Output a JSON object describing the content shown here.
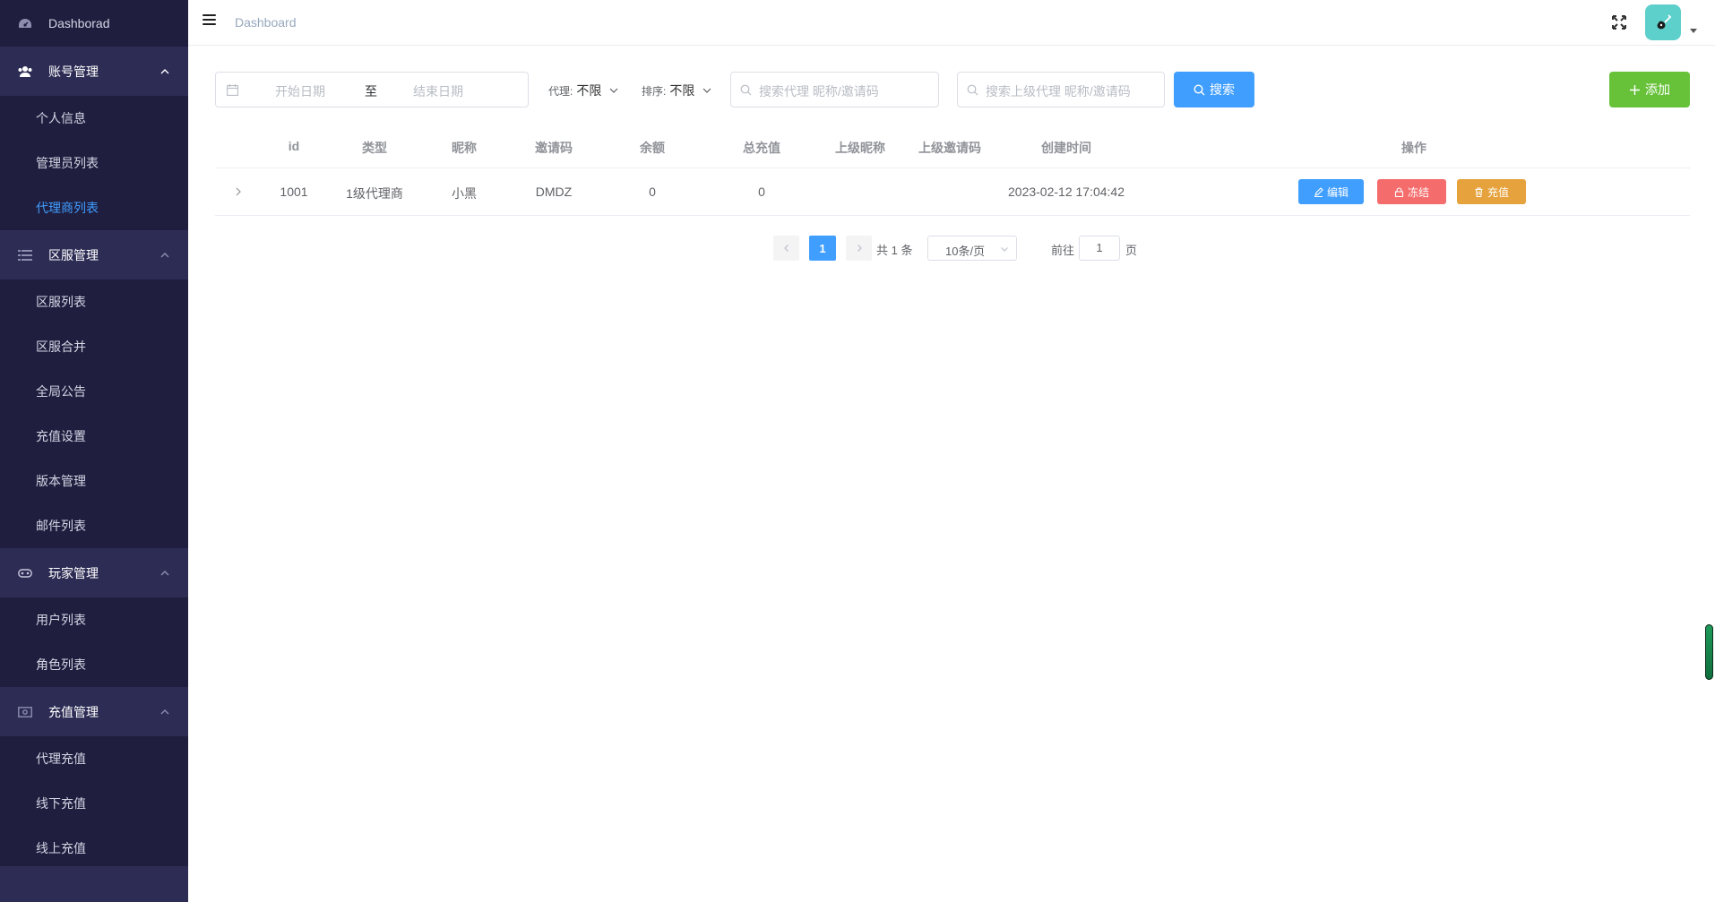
{
  "header": {
    "breadcrumb": "Dashboard"
  },
  "sidebar": {
    "top_item": {
      "label": "Dashborad",
      "icon": "dashboard-icon"
    },
    "groups": [
      {
        "label": "账号管理",
        "icon": "users-icon",
        "items": [
          {
            "label": "个人信息"
          },
          {
            "label": "管理员列表"
          },
          {
            "label": "代理商列表",
            "active": true
          }
        ]
      },
      {
        "label": "区服管理",
        "icon": "list-icon",
        "items": [
          {
            "label": "区服列表"
          },
          {
            "label": "区服合并"
          },
          {
            "label": "全局公告"
          },
          {
            "label": "充值设置"
          },
          {
            "label": "版本管理"
          },
          {
            "label": "邮件列表"
          }
        ]
      },
      {
        "label": "玩家管理",
        "icon": "gamepad-icon",
        "items": [
          {
            "label": "用户列表"
          },
          {
            "label": "角色列表"
          }
        ]
      },
      {
        "label": "充值管理",
        "icon": "money-icon",
        "items": [
          {
            "label": "代理充值"
          },
          {
            "label": "线下充值"
          },
          {
            "label": "线上充值"
          }
        ]
      }
    ]
  },
  "filters": {
    "date_start_placeholder": "开始日期",
    "date_separator": "至",
    "date_end_placeholder": "结束日期",
    "agent_label": "代理:",
    "agent_value": "不限",
    "sort_label": "排序:",
    "sort_value": "不限",
    "search_placeholder": "搜索代理 昵称/邀请码",
    "parent_search_placeholder": "搜索上级代理 昵称/邀请码",
    "search_button": "搜索",
    "add_button": "添加"
  },
  "table": {
    "headers": [
      "id",
      "类型",
      "昵称",
      "邀请码",
      "余额",
      "总充值",
      "上级昵称",
      "上级邀请码",
      "创建时间",
      "操作"
    ],
    "rows": [
      {
        "id": "1001",
        "type": "1级代理商",
        "nickname": "小黑",
        "invite_code": "DMDZ",
        "balance": "0",
        "total_recharge": "0",
        "parent_nickname": "",
        "parent_invite_code": "",
        "created_at": "2023-02-12 17:04:42",
        "actions": {
          "edit": "编辑",
          "freeze": "冻结",
          "recharge": "充值"
        }
      }
    ]
  },
  "pagination": {
    "current_page": "1",
    "total_text": "共 1 条",
    "page_size": "10条/页",
    "goto_label": "前往",
    "goto_value": "1",
    "goto_unit": "页"
  },
  "colors": {
    "sidebar_bg": "#1f1e3f",
    "sidebar_group_bg": "#2d2c55",
    "primary": "#409eff",
    "success": "#67c23a",
    "danger": "#f56c6c",
    "warning": "#e6a23c",
    "avatar_bg": "#5ed0cc"
  }
}
